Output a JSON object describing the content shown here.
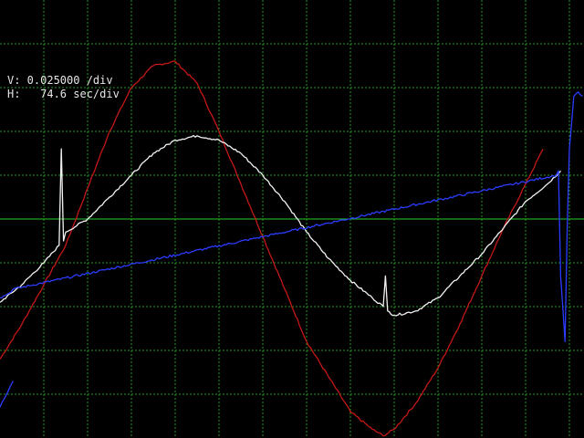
{
  "readout": {
    "vertical": "V: 0.025000 /div",
    "horizontal": "H:   74.6 sec/div"
  },
  "colors": {
    "background": "#000000",
    "grid": "#1f9a1f",
    "center_line": "#2ecc2e",
    "trace_red": "#c41818",
    "trace_white": "#f2f2f2",
    "trace_blue": "#2b3cff"
  },
  "chart_data": {
    "type": "line",
    "title": "",
    "xlabel": "",
    "ylabel": "",
    "x_unit": "div",
    "y_unit": "div",
    "xlim": [
      0,
      13.33
    ],
    "ylim": [
      -5,
      5
    ],
    "grid": true,
    "legend": "none",
    "series": [
      {
        "color": "#c41818",
        "x": [
          0.0,
          0.5,
          1.0,
          1.5,
          2.0,
          2.5,
          3.0,
          3.5,
          4.0,
          4.5,
          5.0,
          5.5,
          6.0,
          6.5,
          7.0,
          7.5,
          8.0,
          8.5,
          8.75,
          9.0,
          9.5,
          10.0,
          10.5,
          11.0,
          11.5,
          12.0,
          12.4
        ],
        "y": [
          -3.2,
          -2.4,
          -1.5,
          -0.6,
          0.7,
          2.0,
          3.0,
          3.5,
          3.6,
          3.1,
          2.0,
          0.8,
          -0.4,
          -1.6,
          -2.8,
          -3.6,
          -4.4,
          -4.8,
          -4.95,
          -4.8,
          -4.2,
          -3.4,
          -2.4,
          -1.3,
          -0.2,
          0.8,
          1.6
        ]
      },
      {
        "color": "#f2f2f2",
        "x": [
          0.0,
          0.5,
          1.0,
          1.35,
          1.4,
          1.45,
          1.5,
          2.0,
          2.5,
          3.0,
          3.5,
          4.0,
          4.5,
          5.0,
          5.5,
          6.0,
          6.5,
          7.0,
          7.5,
          8.0,
          8.5,
          8.75,
          8.8,
          8.85,
          9.0,
          9.5,
          10.0,
          10.5,
          11.0,
          11.5,
          12.0,
          12.5,
          12.8
        ],
        "y": [
          -1.9,
          -1.5,
          -1.0,
          -0.6,
          1.6,
          -0.5,
          -0.3,
          0.0,
          0.5,
          1.0,
          1.5,
          1.8,
          1.9,
          1.8,
          1.5,
          1.0,
          0.4,
          -0.3,
          -0.9,
          -1.4,
          -1.8,
          -2.0,
          -1.3,
          -2.1,
          -2.2,
          -2.1,
          -1.8,
          -1.3,
          -0.8,
          -0.2,
          0.4,
          0.8,
          1.1
        ]
      },
      {
        "color": "#2b3cff",
        "x": [
          0.0,
          0.2,
          0.3,
          12.7,
          12.75,
          12.8,
          12.9,
          12.95,
          13.0,
          13.1,
          13.2,
          13.3
        ],
        "y": [
          -1.8,
          -1.7,
          -1.6,
          1.0,
          1.1,
          -1.3,
          -2.8,
          -0.2,
          1.6,
          2.8,
          2.9,
          2.8
        ]
      },
      {
        "color": "#2b3cff",
        "x": [
          0.0,
          0.1,
          0.2,
          0.3
        ],
        "y": [
          -4.3,
          -4.1,
          -3.9,
          -3.7
        ]
      }
    ]
  }
}
